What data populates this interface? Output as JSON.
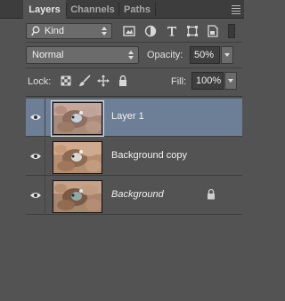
{
  "tabs": [
    {
      "label": "Layers",
      "active": true
    },
    {
      "label": "Channels",
      "active": false
    },
    {
      "label": "Paths",
      "active": false
    }
  ],
  "filter": {
    "kind_label": "Kind",
    "icons": [
      "image-filter-icon",
      "adjustment-filter-icon",
      "type-filter-icon",
      "shape-filter-icon",
      "smart-object-filter-icon",
      "filter-toggle"
    ]
  },
  "blend": {
    "mode": "Normal",
    "opacity_label": "Opacity:",
    "opacity_value": "50%"
  },
  "lock": {
    "label": "Lock:",
    "icons": [
      "lock-transparent-icon",
      "lock-image-icon",
      "lock-position-icon",
      "lock-all-icon"
    ],
    "fill_label": "Fill:",
    "fill_value": "100%"
  },
  "layers": [
    {
      "name": "Layer 1",
      "selected": true,
      "visible": true,
      "italic": false,
      "locked": false
    },
    {
      "name": "Background copy",
      "selected": false,
      "visible": true,
      "italic": false,
      "locked": false
    },
    {
      "name": "Background",
      "selected": false,
      "visible": true,
      "italic": true,
      "locked": true
    }
  ],
  "colors": {
    "panel": "#535353",
    "selection": "#6d7f96",
    "tabbar": "#3d3d3d"
  }
}
